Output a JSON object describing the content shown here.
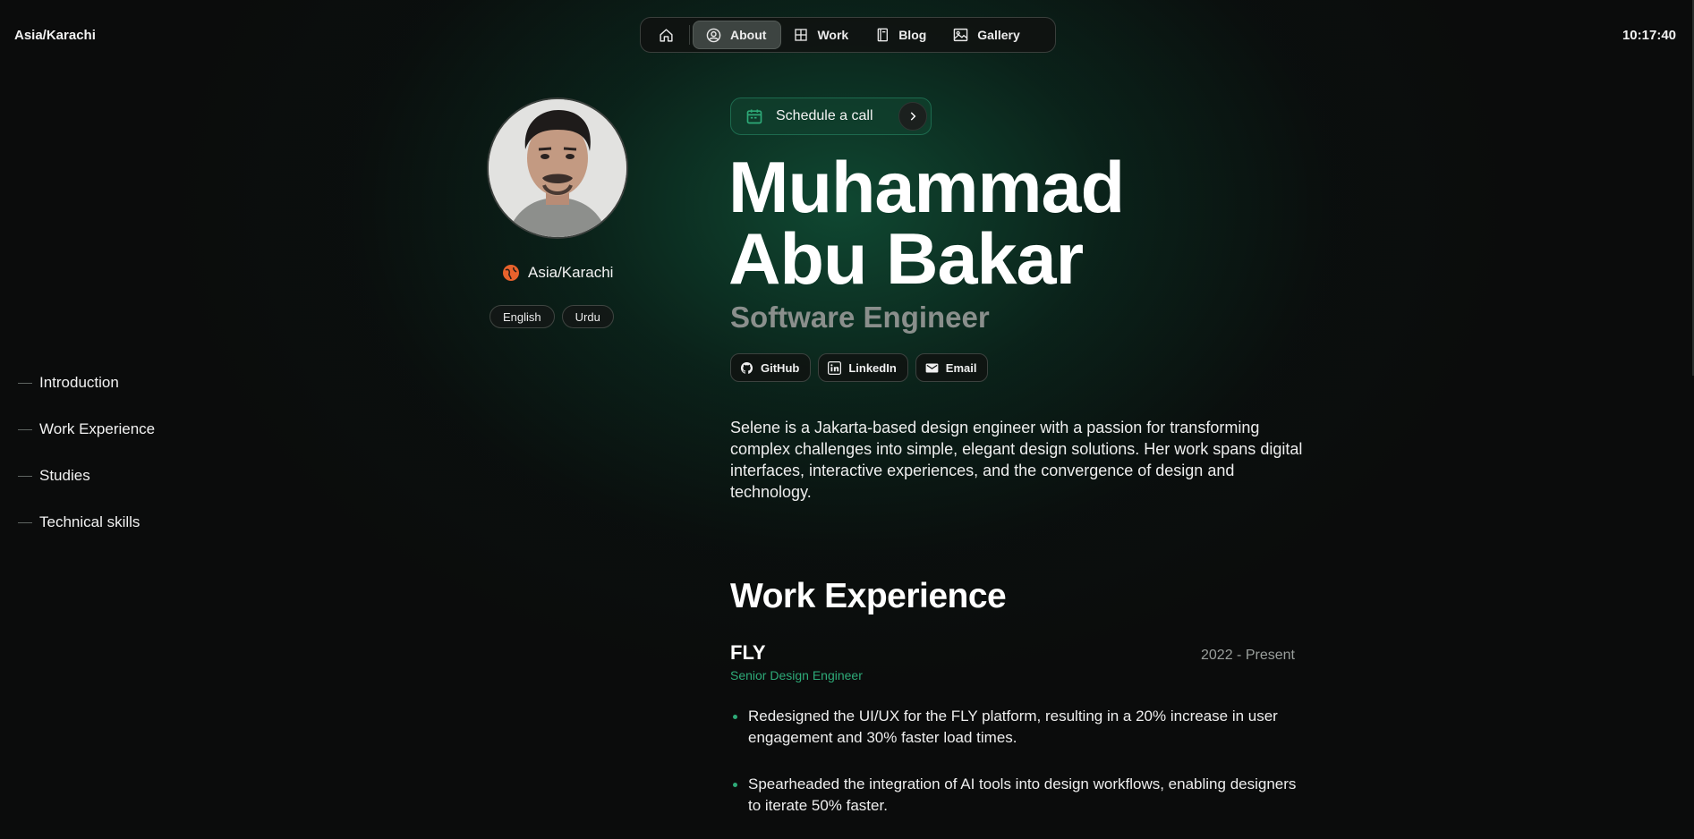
{
  "topbar": {
    "timezone": "Asia/Karachi",
    "time": "10:17:40"
  },
  "nav": {
    "home_icon": "home-icon",
    "items": [
      {
        "label": "About",
        "icon": "person-circle-icon",
        "active": true
      },
      {
        "label": "Work",
        "icon": "grid-icon",
        "active": false
      },
      {
        "label": "Blog",
        "icon": "book-icon",
        "active": false
      },
      {
        "label": "Gallery",
        "icon": "image-icon",
        "active": false
      }
    ]
  },
  "toc": {
    "items": [
      "Introduction",
      "Work Experience",
      "Studies",
      "Technical skills"
    ]
  },
  "profile": {
    "location": "Asia/Karachi",
    "languages": [
      "English",
      "Urdu"
    ]
  },
  "hero": {
    "schedule_label": "Schedule a call",
    "name_line1": "Muhammad",
    "name_line2": "Abu Bakar",
    "role": "Software Engineer",
    "socials": [
      {
        "label": "GitHub",
        "icon": "github-icon"
      },
      {
        "label": "LinkedIn",
        "icon": "linkedin-icon"
      },
      {
        "label": "Email",
        "icon": "email-icon"
      }
    ],
    "bio": "Selene is a Jakarta-based design engineer with a passion for transforming complex challenges into simple, elegant design solutions. Her work spans digital interfaces, interactive experiences, and the convergence of design and technology."
  },
  "work": {
    "title": "Work Experience",
    "jobs": [
      {
        "company": "FLY",
        "period": "2022 - Present",
        "role": "Senior Design Engineer",
        "bullets": [
          "Redesigned the UI/UX for the FLY platform, resulting in a 20% increase in user engagement and 30% faster load times.",
          "Spearheaded the integration of AI tools into design workflows, enabling designers to iterate 50% faster."
        ]
      }
    ]
  },
  "colors": {
    "accent": "#2eaa78",
    "background": "#0b0c0c",
    "muted": "#8a8f8c"
  }
}
